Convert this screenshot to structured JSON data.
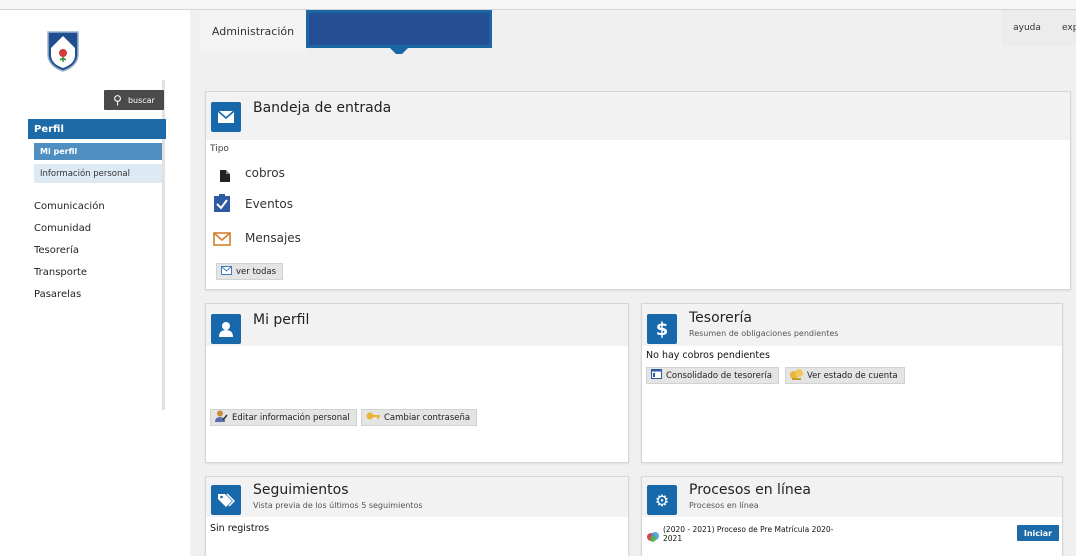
{
  "header": {
    "tab_admin": "Administración",
    "link_help": "ayuda",
    "link_exp": "exp"
  },
  "sidebar": {
    "search_label": "buscar",
    "section_label": "Perfil",
    "sub_items": [
      "Mi perfil",
      "Información personal"
    ],
    "items": [
      "Comunicación",
      "Comunidad",
      "Tesorería",
      "Transporte",
      "Pasarelas"
    ]
  },
  "inbox": {
    "title": "Bandeja de entrada",
    "type_label": "Tipo",
    "rows": [
      {
        "label": "cobros",
        "icon": "document-icon"
      },
      {
        "label": "Eventos",
        "icon": "clipboard-check-icon"
      },
      {
        "label": "Mensajes",
        "icon": "envelope-icon"
      }
    ],
    "view_all": "ver todas"
  },
  "profile": {
    "title": "Mi perfil",
    "edit_btn": "Editar información personal",
    "password_btn": "Cambiar contraseña"
  },
  "treasury": {
    "title": "Tesorería",
    "subtitle": "Resumen de obligaciones pendientes",
    "status": "No hay cobros pendientes",
    "consolidated_btn": "Consolidado de tesorería",
    "account_btn": "Ver estado de cuenta"
  },
  "tracking": {
    "title": "Seguimientos",
    "subtitle": "Vista previa de los últimos 5 seguimientos",
    "status": "Sin registros"
  },
  "processes": {
    "title": "Procesos en línea",
    "subtitle": "Procesos en línea",
    "item_line1": "(2020 - 2021) Proceso de Pre Matrícula 2020-",
    "item_line2": "2021",
    "start_btn": "Iniciar"
  },
  "colors": {
    "brand_blue": "#1769ac",
    "active_tab": "#244f94",
    "panel_header": "#f2f2f2"
  }
}
